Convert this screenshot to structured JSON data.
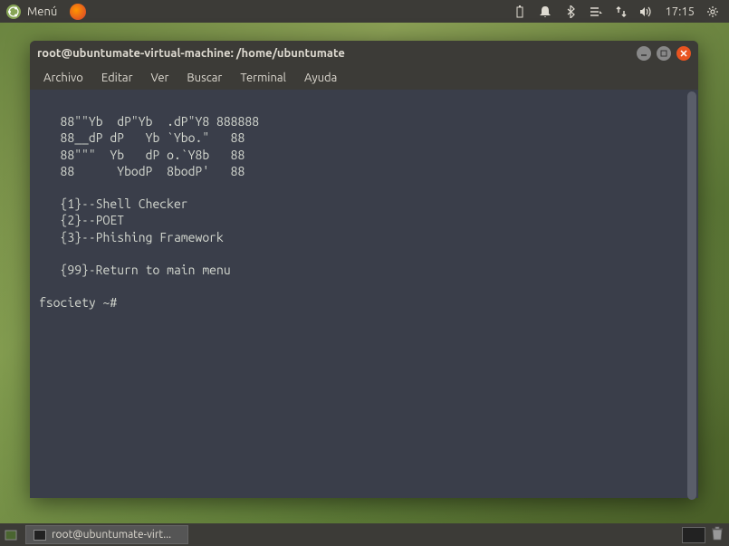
{
  "top_panel": {
    "menu_label": "Menú",
    "clock": "17:15"
  },
  "terminal": {
    "title": "root@ubuntumate-virtual-machine: /home/ubuntumate",
    "menubar": [
      "Archivo",
      "Editar",
      "Ver",
      "Buscar",
      "Terminal",
      "Ayuda"
    ],
    "ascii_art": "   88\"\"Yb  dP\"Yb  .dP\"Y8 888888\n   88__dP dP   Yb `Ybo.\"   88\n   88\"\"\"  Yb   dP o.`Y8b   88\n   88      YbodP  8bodP'   88",
    "menu_options": [
      "   {1}--Shell Checker",
      "   {2}--POET",
      "   {3}--Phishing Framework",
      "",
      "   {99}-Return to main menu"
    ],
    "prompt": "fsociety ~# "
  },
  "bottom_panel": {
    "task_label": "root@ubuntumate-virt..."
  }
}
